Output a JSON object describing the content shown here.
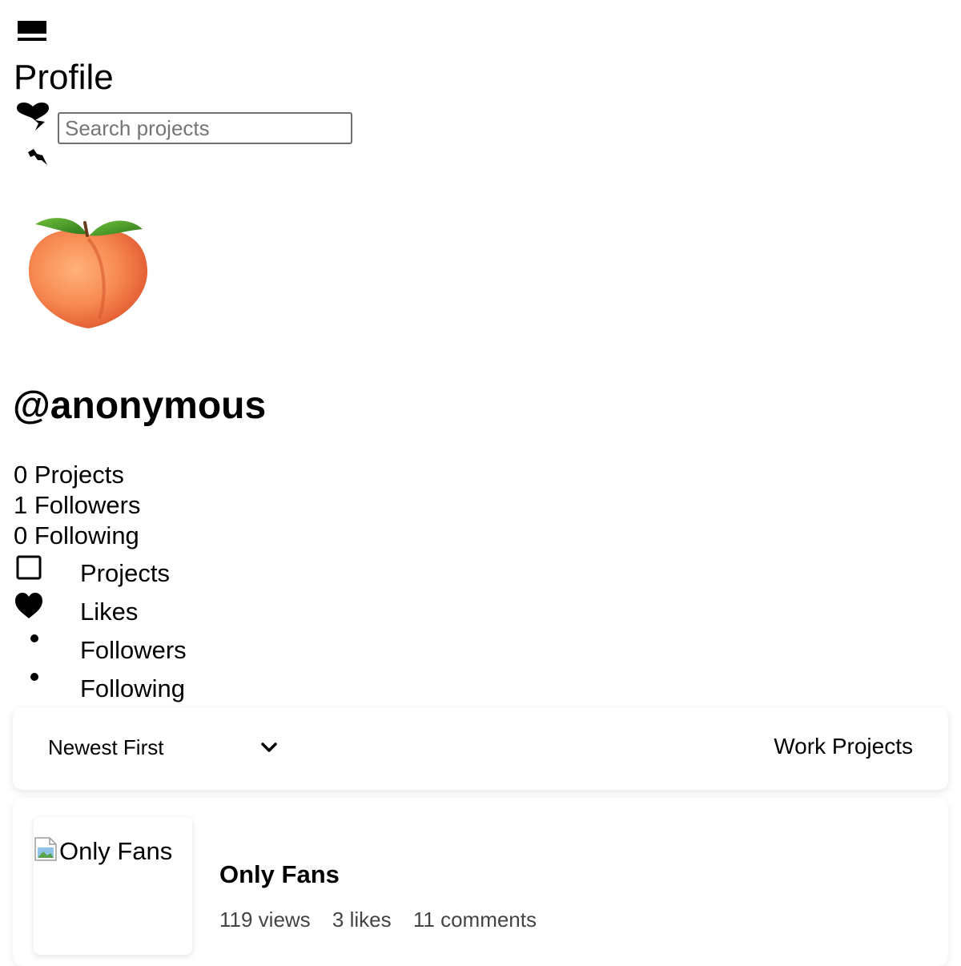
{
  "header": {
    "menu_icon": "menu-icon",
    "page_title": "Profile",
    "logo_icon": "heart-logo-icon"
  },
  "search": {
    "placeholder": "Search projects",
    "value": ""
  },
  "profile": {
    "avatar_icon": "peach-avatar-icon",
    "username": "@anonymous",
    "stats": {
      "projects": "0 Projects",
      "followers": "1 Followers",
      "following": "0 Following"
    }
  },
  "tabs": [
    {
      "label": "Projects",
      "icon": "square-outline-icon"
    },
    {
      "label": "Likes",
      "icon": "heart-icon"
    },
    {
      "label": "Followers",
      "icon": "bullet-icon"
    },
    {
      "label": "Following",
      "icon": "bullet-icon"
    }
  ],
  "filters": {
    "sort_selected": "Newest First",
    "category_label": "Work Projects"
  },
  "projects": [
    {
      "thumbnail_alt": "Only Fans",
      "title": "Only Fans",
      "views": "119 views",
      "likes": "3 likes",
      "comments": "11 comments"
    }
  ],
  "colors": {
    "text": "#000000",
    "muted": "#444444",
    "input_border": "#6f6f6f",
    "peach": "#f5884f",
    "leaf": "#3f8f2a"
  }
}
